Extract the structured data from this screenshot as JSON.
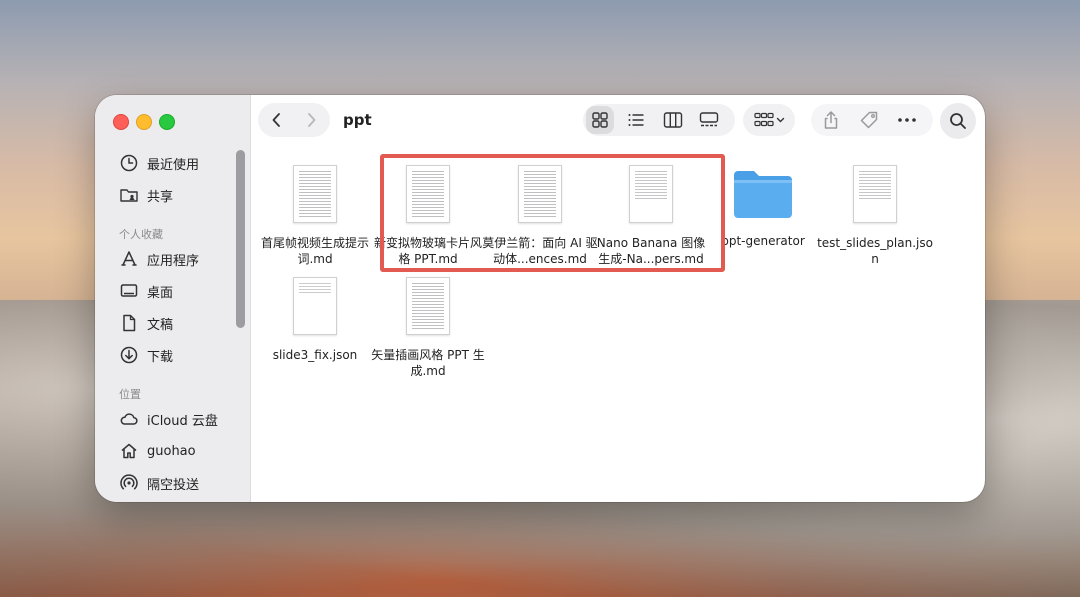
{
  "window": {
    "folder_title": "ppt"
  },
  "sidebar": {
    "favorites": [
      {
        "label": "最近使用",
        "icon": "clock-icon"
      },
      {
        "label": "共享",
        "icon": "shared-folder-icon"
      }
    ],
    "section_personal": "个人收藏",
    "personal": [
      {
        "label": "应用程序",
        "icon": "applications-icon"
      },
      {
        "label": "桌面",
        "icon": "desktop-icon"
      },
      {
        "label": "文稿",
        "icon": "document-icon"
      },
      {
        "label": "下载",
        "icon": "download-icon"
      }
    ],
    "section_locations": "位置",
    "locations": [
      {
        "label": "iCloud 云盘",
        "icon": "cloud-icon"
      },
      {
        "label": "guohao",
        "icon": "home-icon"
      },
      {
        "label": "隔空投送",
        "icon": "airdrop-icon"
      }
    ]
  },
  "files": [
    {
      "name": "首尾帧视频生成提示词.md",
      "kind": "document"
    },
    {
      "name": "新变拟物玻璃卡片风格 PPT.md",
      "kind": "document"
    },
    {
      "name": "莫伊兰箭：面向 AI 驱动体...ences.md",
      "kind": "document"
    },
    {
      "name": "Nano Banana 图像生成-Na...pers.md",
      "kind": "document"
    },
    {
      "name": "ppt-generator",
      "kind": "folder"
    },
    {
      "name": "test_slides_plan.json",
      "kind": "document"
    },
    {
      "name": "slide3_fix.json",
      "kind": "document"
    },
    {
      "name": "矢量插画风格 PPT 生成.md",
      "kind": "document"
    }
  ],
  "colors": {
    "highlight": "#e25a51",
    "folder": "#5aaef0"
  }
}
